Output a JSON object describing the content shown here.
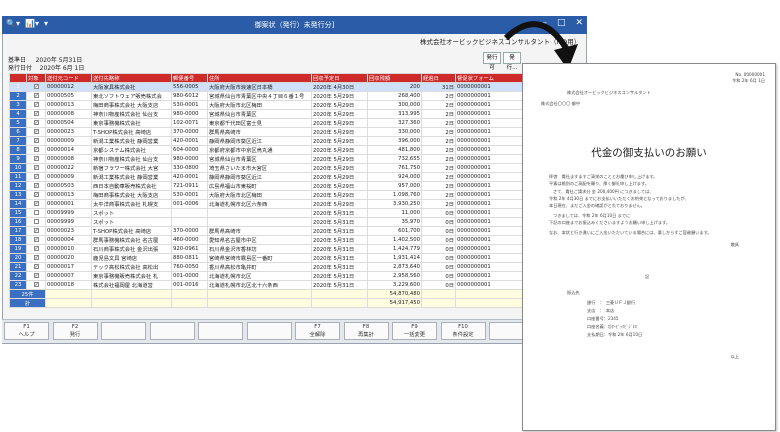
{
  "window": {
    "title": "御案状（発行）未発行分]",
    "quick_icons": [
      "🔍▾",
      "📊▾",
      "▾"
    ],
    "controls": [
      "—",
      "□",
      "✕"
    ]
  },
  "company": "株式会社オービックビジネスコンサルタント（MO用）",
  "info": {
    "base_label": "基準日",
    "base_date": "2020年 5月31日",
    "issue_label": "発行日付",
    "issue_date": "2020年 6月 1日"
  },
  "top_buttons": [
    "発行可",
    "発行..."
  ],
  "table": {
    "headers": [
      "",
      "対象",
      "送付元コード",
      "送付先略称",
      "郵便番号",
      "住所",
      "回収予定日",
      "回収残額",
      "経過日",
      "督促状フォーム"
    ],
    "rows": [
      {
        "no": "1",
        "checked": true,
        "code": "00000012",
        "name": "大阪家具株式会社",
        "zip": "556-0005",
        "addr": "大阪府大阪市浪速区日本橋",
        "date": "2020年 4月30日",
        "amount": "200",
        "days": "31日",
        "form": "0000000001",
        "sel": true
      },
      {
        "no": "2",
        "checked": true,
        "code": "00000505",
        "name": "東北ソフトウェア販売株式会",
        "zip": "980-6012",
        "addr": "宮城県仙台市青葉区中央４丁目６番１号",
        "date": "2020年 5月29日",
        "amount": "268,400",
        "days": "2日",
        "form": "0000000001",
        "sel": false
      },
      {
        "no": "3",
        "checked": true,
        "code": "00000013",
        "name": "梅田商事株式会社 大阪支店",
        "zip": "530-0001",
        "addr": "大阪府大阪市北区梅田",
        "date": "2020年 5月29日",
        "amount": "300,000",
        "days": "2日",
        "form": "0000000001",
        "sel": false
      },
      {
        "no": "4",
        "checked": true,
        "code": "00000008",
        "name": "神奈川物産株式会社 仙台支",
        "zip": "980-0000",
        "addr": "宮城県仙台市青葉区",
        "date": "2020年 5月29日",
        "amount": "313,995",
        "days": "2日",
        "form": "0000000001",
        "sel": false
      },
      {
        "no": "5",
        "checked": true,
        "code": "00000504",
        "name": "東京事務機株式会社",
        "zip": "102-0071",
        "addr": "東京都千代田区富士見",
        "date": "2020年 5月29日",
        "amount": "327,360",
        "days": "2日",
        "form": "0000000001",
        "sel": false
      },
      {
        "no": "6",
        "checked": true,
        "code": "00000023",
        "name": "T-SHOP株式会社 高崎店",
        "zip": "370-0000",
        "addr": "群馬県高崎市",
        "date": "2020年 5月29日",
        "amount": "330,000",
        "days": "2日",
        "form": "0000000001",
        "sel": false
      },
      {
        "no": "7",
        "checked": true,
        "code": "00000009",
        "name": "新潟工業株式会社 静岡営業",
        "zip": "420-0001",
        "addr": "静岡県静岡市葵区近江",
        "date": "2020年 5月29日",
        "amount": "396,000",
        "days": "2日",
        "form": "0000000001",
        "sel": false
      },
      {
        "no": "8",
        "checked": true,
        "code": "00000014",
        "name": "京都システム株式会社",
        "zip": "604-0000",
        "addr": "京都府京都市中京区烏丸通",
        "date": "2020年 5月29日",
        "amount": "481,800",
        "days": "2日",
        "form": "0000000001",
        "sel": false
      },
      {
        "no": "9",
        "checked": true,
        "code": "00000008",
        "name": "神奈川物産株式会社 仙台支",
        "zip": "980-0000",
        "addr": "宮城県仙台市青葉区",
        "date": "2020年 5月29日",
        "amount": "732,655",
        "days": "2日",
        "form": "0000000001",
        "sel": false
      },
      {
        "no": "10",
        "checked": true,
        "code": "00000022",
        "name": "新宿フラワー株式会社 大宮",
        "zip": "330-0800",
        "addr": "埼玉県さいたま市大宮区",
        "date": "2020年 5月29日",
        "amount": "761,750",
        "days": "2日",
        "form": "0000000001",
        "sel": false
      },
      {
        "no": "11",
        "checked": true,
        "code": "00000009",
        "name": "新潟工業株式会社 静岡営業",
        "zip": "420-0001",
        "addr": "静岡県静岡市葵区近江",
        "date": "2020年 5月29日",
        "amount": "924,000",
        "days": "2日",
        "form": "0000000001",
        "sel": false
      },
      {
        "no": "12",
        "checked": true,
        "code": "00000503",
        "name": "西日本自動車販売株式会社",
        "zip": "721-0911",
        "addr": "広島県福山市東桜町",
        "date": "2020年 5月29日",
        "amount": "957,000",
        "days": "2日",
        "form": "0000000001",
        "sel": false
      },
      {
        "no": "13",
        "checked": true,
        "code": "00000013",
        "name": "梅田商事株式会社 大阪支店",
        "zip": "530-0001",
        "addr": "大阪府大阪市北区梅田",
        "date": "2020年 5月29日",
        "amount": "1,098,760",
        "days": "2日",
        "form": "0000000001",
        "sel": false
      },
      {
        "no": "14",
        "checked": true,
        "code": "00000001",
        "name": "太平洋商事株式会社 札幌支",
        "zip": "001-0006",
        "addr": "北海道札幌市北区六条西",
        "date": "2020年 5月29日",
        "amount": "3,930,250",
        "days": "2日",
        "form": "0000000001",
        "sel": false
      },
      {
        "no": "15",
        "checked": false,
        "code": "00009999",
        "name": "スポット",
        "zip": "",
        "addr": "",
        "date": "2020年 5月31日",
        "amount": "11,000",
        "days": "0日",
        "form": "0000000001",
        "sel": false
      },
      {
        "no": "16",
        "checked": false,
        "code": "00009999",
        "name": "スポット",
        "zip": "",
        "addr": "",
        "date": "2020年 5月31日",
        "amount": "35,970",
        "days": "0日",
        "form": "0000000001",
        "sel": false
      },
      {
        "no": "17",
        "checked": true,
        "code": "00000023",
        "name": "T-SHOP株式会社 高崎店",
        "zip": "370-0000",
        "addr": "群馬県高崎市",
        "date": "2020年 5月31日",
        "amount": "601,700",
        "days": "0日",
        "form": "0000000001",
        "sel": false
      },
      {
        "no": "18",
        "checked": true,
        "code": "00000004",
        "name": "群馬事務機株式会社 名古屋",
        "zip": "460-0000",
        "addr": "愛知県名古屋市中区",
        "date": "2020年 5月31日",
        "amount": "1,402,500",
        "days": "0日",
        "form": "0000000001",
        "sel": false
      },
      {
        "no": "19",
        "checked": true,
        "code": "00000010",
        "name": "石川商事株式会社 金沢出張",
        "zip": "920-0961",
        "addr": "石川県金沢市香林坊",
        "date": "2020年 5月31日",
        "amount": "1,424,779",
        "days": "0日",
        "form": "0000000001",
        "sel": false
      },
      {
        "no": "20",
        "checked": true,
        "code": "00000020",
        "name": "鹿児島文具 宮崎店",
        "zip": "880-0811",
        "addr": "宮崎県宮崎市霧島区一番町",
        "date": "2020年 5月31日",
        "amount": "1,931,414",
        "days": "0日",
        "form": "0000000001",
        "sel": false
      },
      {
        "no": "21",
        "checked": true,
        "code": "00000017",
        "name": "テック高松株式会社 高松出",
        "zip": "760-0050",
        "addr": "香川県高松市亀井町",
        "date": "2020年 5月31日",
        "amount": "2,873,640",
        "days": "0日",
        "form": "0000000001",
        "sel": false
      },
      {
        "no": "22",
        "checked": true,
        "code": "00000007",
        "name": "東京事務機販売株式会社 札",
        "zip": "001-0000",
        "addr": "北海道札幌市北区",
        "date": "2020年 5月31日",
        "amount": "2,958,560",
        "days": "0日",
        "form": "0000000001",
        "sel": false
      },
      {
        "no": "23",
        "checked": true,
        "code": "00000018",
        "name": "株式会社福岡屋 北海道営",
        "zip": "001-0016",
        "addr": "北海道札幌市北区北十六条西",
        "date": "2020年 5月31日",
        "amount": "3,229,600",
        "days": "0日",
        "form": "0000000001",
        "sel": false
      }
    ],
    "summary": [
      {
        "label": "25件",
        "amount": "54,870,480"
      },
      {
        "label": "計",
        "amount": "54,917,450"
      }
    ]
  },
  "fkeys": [
    {
      "key": "F1",
      "label": "ヘルプ"
    },
    {
      "key": "F2",
      "label": "発行"
    },
    {
      "key": "",
      "label": ""
    },
    {
      "key": "",
      "label": ""
    },
    {
      "key": "",
      "label": ""
    },
    {
      "key": "",
      "label": ""
    },
    {
      "key": "F7",
      "label": "全解除"
    },
    {
      "key": "F8",
      "label": "再集計"
    },
    {
      "key": "F9",
      "label": "一括変更"
    },
    {
      "key": "F10",
      "label": "条件設定"
    },
    {
      "key": "",
      "label": ""
    },
    {
      "key": "",
      "label": ""
    }
  ],
  "doc": {
    "docno": "No.  00000001",
    "date": "令和 2年 6月 1日",
    "sender": "株式会社オービックビジネスコンサルタント",
    "recipient": "株式会社〇〇〇 御中",
    "subject": "代金の御支払いのお願い",
    "body1": "拝啓　貴社ますますご清栄のこととお慶び申し上げます。",
    "body2": "平素は格別のご高配を賜り、厚く御礼申し上げます。",
    "body3": "さて、貴社ご請求分 金 200,400円 につきましては、",
    "body4": "令和 2年 4月30日 までにお支払いいただくお約束となっておりましたが、",
    "body5": "本日現在、まだご入金の確認がとれておりません。",
    "body6": "つきましては、令和 2年 6月10日 までに",
    "body7": "下記の口座までお振込みくださいますようお願い申し上げます。",
    "body8": "なお、本状と行き違いにご入金いただいている場合には、悪しからずご容赦願います。",
    "closing": "敬具",
    "ki": "記",
    "bank_title": "振込先",
    "bank1": "銀行　：　三菱ＵＦＪ銀行",
    "bank2": "支店　：　本店",
    "bank3": "口座番号：2345",
    "bank4": "口座名義：ｶ)ｵｰﾋﾞｯｸﾋﾞｼﾞﾈｽ",
    "bank5": "支払期日：令和 2年 6月10日",
    "ijo": "以上"
  }
}
